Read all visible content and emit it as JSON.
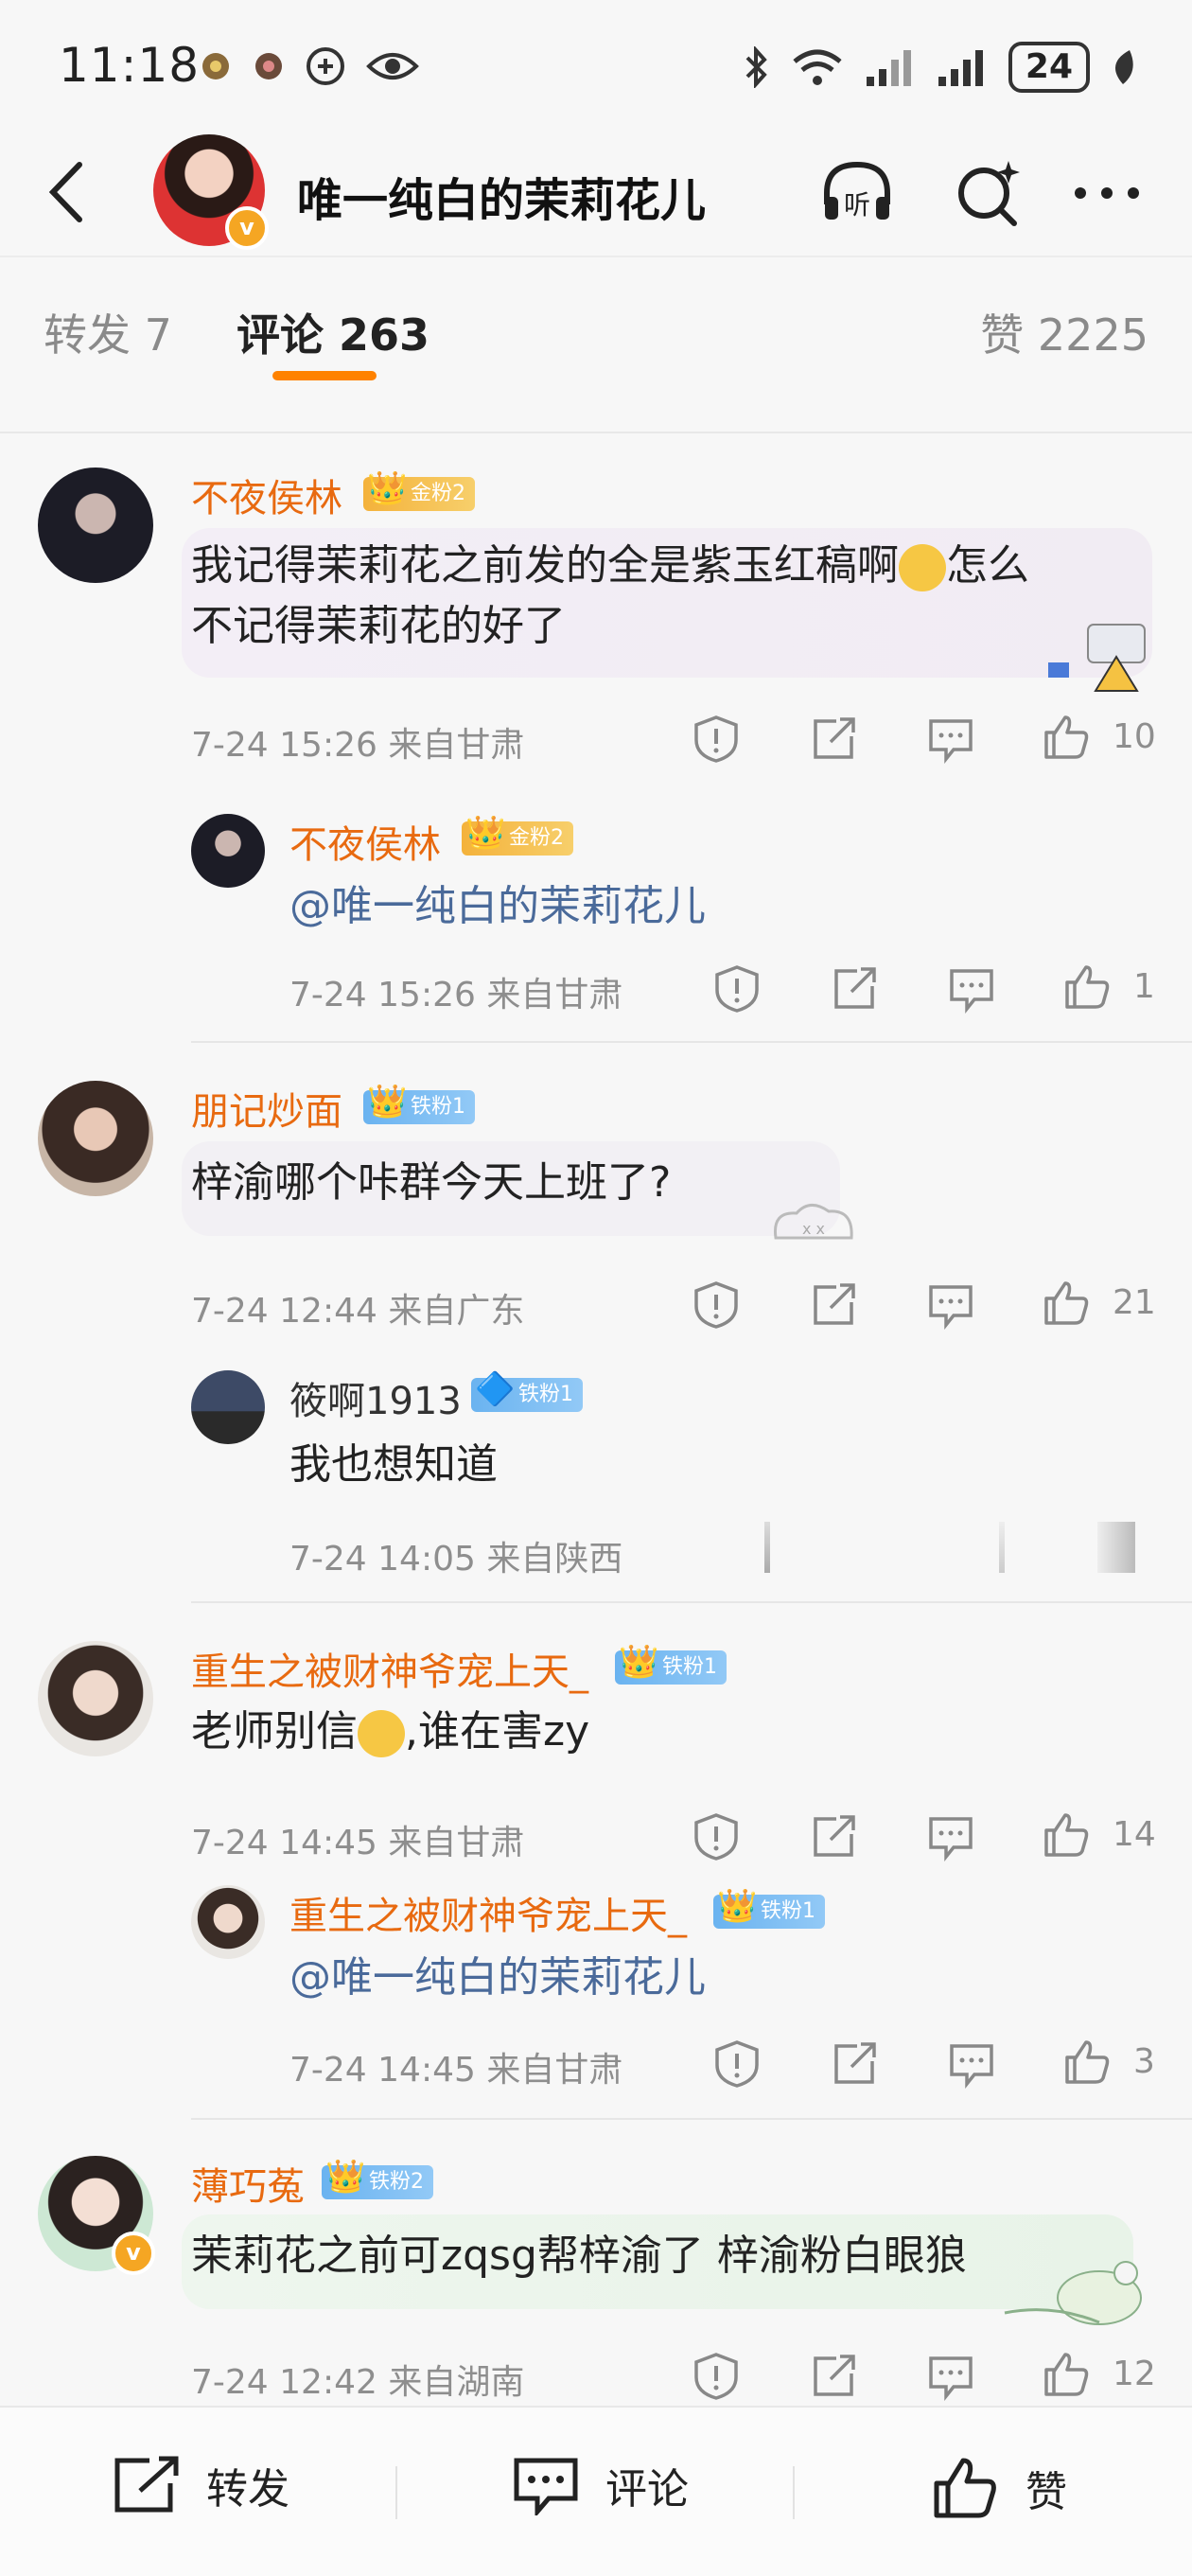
{
  "status": {
    "time": "11:18",
    "battery": "24"
  },
  "header": {
    "title": "唯一纯白的茉莉花儿"
  },
  "tabs": {
    "repost": "转发 7",
    "comments": "评论 263",
    "likes": "赞 2225"
  },
  "comments": [
    {
      "name": "不夜侯林",
      "badge": "金粉2",
      "text_1": "我记得茉莉花之前发的全是紫玉红稿啊",
      "text_2": "怎么",
      "text_3": "不记得茉莉花的好了",
      "meta": "7-24 15:26 来自甘肃",
      "likes": "10",
      "reply": {
        "name": "不夜侯林",
        "badge": "金粉2",
        "text": "@唯一纯白的茉莉花儿",
        "meta": "7-24 15:26 来自甘肃",
        "likes": "1"
      }
    },
    {
      "name": "朋记炒面",
      "badge": "铁粉1",
      "text": "梓渝哪个咔群今天上班了?",
      "meta": "7-24 12:44 来自广东",
      "likes": "21",
      "reply": {
        "name": "筱啊1913",
        "badge": "铁粉1",
        "text": "我也想知道",
        "meta": "7-24 14:05 来自陕西"
      }
    },
    {
      "name": "重生之被财神爷宠上天_",
      "badge": "铁粉1",
      "text_1": "老师别信",
      "text_2": ",谁在害zy",
      "meta": "7-24 14:45 来自甘肃",
      "likes": "14",
      "reply": {
        "name": "重生之被财神爷宠上天_",
        "badge": "铁粉1",
        "text": "@唯一纯白的茉莉花儿",
        "meta": "7-24 14:45 来自甘肃",
        "likes": "3"
      }
    },
    {
      "name": "薄巧菟",
      "badge": "铁粉2",
      "text": "茉莉花之前可zqsg帮梓渝了 梓渝粉白眼狼",
      "meta": "7-24 12:42 来自湖南",
      "likes": "12"
    }
  ],
  "bottom": {
    "repost": "转发",
    "comment": "评论",
    "like": "赞"
  },
  "colors": {
    "accent": "#ff8200",
    "username": "#e86a10",
    "mention": "#4a6a9a"
  }
}
